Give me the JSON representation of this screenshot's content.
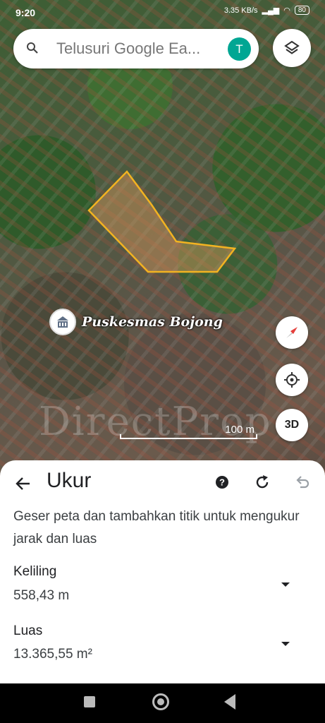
{
  "status": {
    "time": "9:20",
    "speed": "3.35 KB/s",
    "battery": "80"
  },
  "search": {
    "placeholder": "Telusuri Google Ea...",
    "avatar_initial": "T"
  },
  "map": {
    "poi_label": "Puskesmas Bojong",
    "scale_label": "100 m",
    "btn_3d": "3D",
    "watermark": "DirectProp"
  },
  "measure": {
    "title": "Ukur",
    "description": "Geser peta dan tambahkan titik untuk mengukur jarak dan luas",
    "perimeter_label": "Keliling",
    "perimeter_value": "558,43 m",
    "area_label": "Luas",
    "area_value": "13.365,55 m²"
  },
  "colors": {
    "measure_outline": "#f2b321",
    "avatar": "#00a693",
    "compass_red": "#e53935"
  }
}
